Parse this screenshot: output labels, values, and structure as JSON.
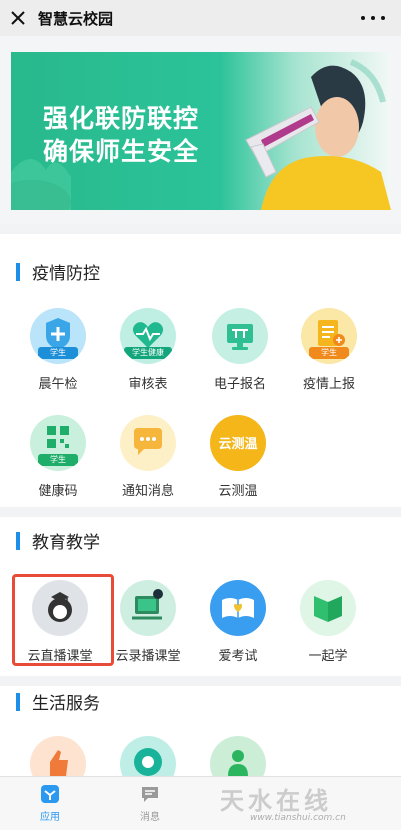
{
  "app": {
    "title": "智慧云校园"
  },
  "banner": {
    "line1": "强化联防联控",
    "line2": "确保师生安全"
  },
  "sections": [
    {
      "title": "疫情防控"
    },
    {
      "title": "教育教学"
    },
    {
      "title": "生活服务"
    }
  ],
  "epidemic": {
    "items": [
      {
        "label": "晨午检",
        "tag": "学生",
        "icon": "shield-plus-icon"
      },
      {
        "label": "审核表",
        "tag": "学生健康",
        "icon": "heart-pulse-icon"
      },
      {
        "label": "电子报名",
        "tag": "",
        "icon": "monitor-icon"
      },
      {
        "label": "疫情上报",
        "tag": "学生",
        "icon": "report-icon"
      },
      {
        "label": "健康码",
        "tag": "学生",
        "icon": "qr-code-icon"
      },
      {
        "label": "通知消息",
        "tag": "",
        "icon": "message-icon"
      },
      {
        "label": "云测温",
        "tag": "云测温",
        "icon": "thermometer-icon"
      }
    ]
  },
  "education": {
    "items": [
      {
        "label": "云直播课堂",
        "icon": "live-class-icon"
      },
      {
        "label": "云录播课堂",
        "icon": "recorded-class-icon"
      },
      {
        "label": "爱考试",
        "icon": "exam-book-icon"
      },
      {
        "label": "一起学",
        "icon": "study-together-icon"
      }
    ]
  },
  "tabbar": {
    "tabs": [
      {
        "label": "应用",
        "icon": "apps-icon",
        "active": true
      },
      {
        "label": "消息",
        "icon": "chat-icon",
        "active": false
      }
    ]
  },
  "watermark": {
    "text": "天水在线",
    "url": "www.tianshui.com.cn"
  },
  "colors": {
    "accent": "#1e8fe8",
    "highlight": "#e84b37",
    "banner_green": "#2cc39a",
    "active_tab": "#2b99f0",
    "inactive_tab": "#9a9a9a"
  }
}
